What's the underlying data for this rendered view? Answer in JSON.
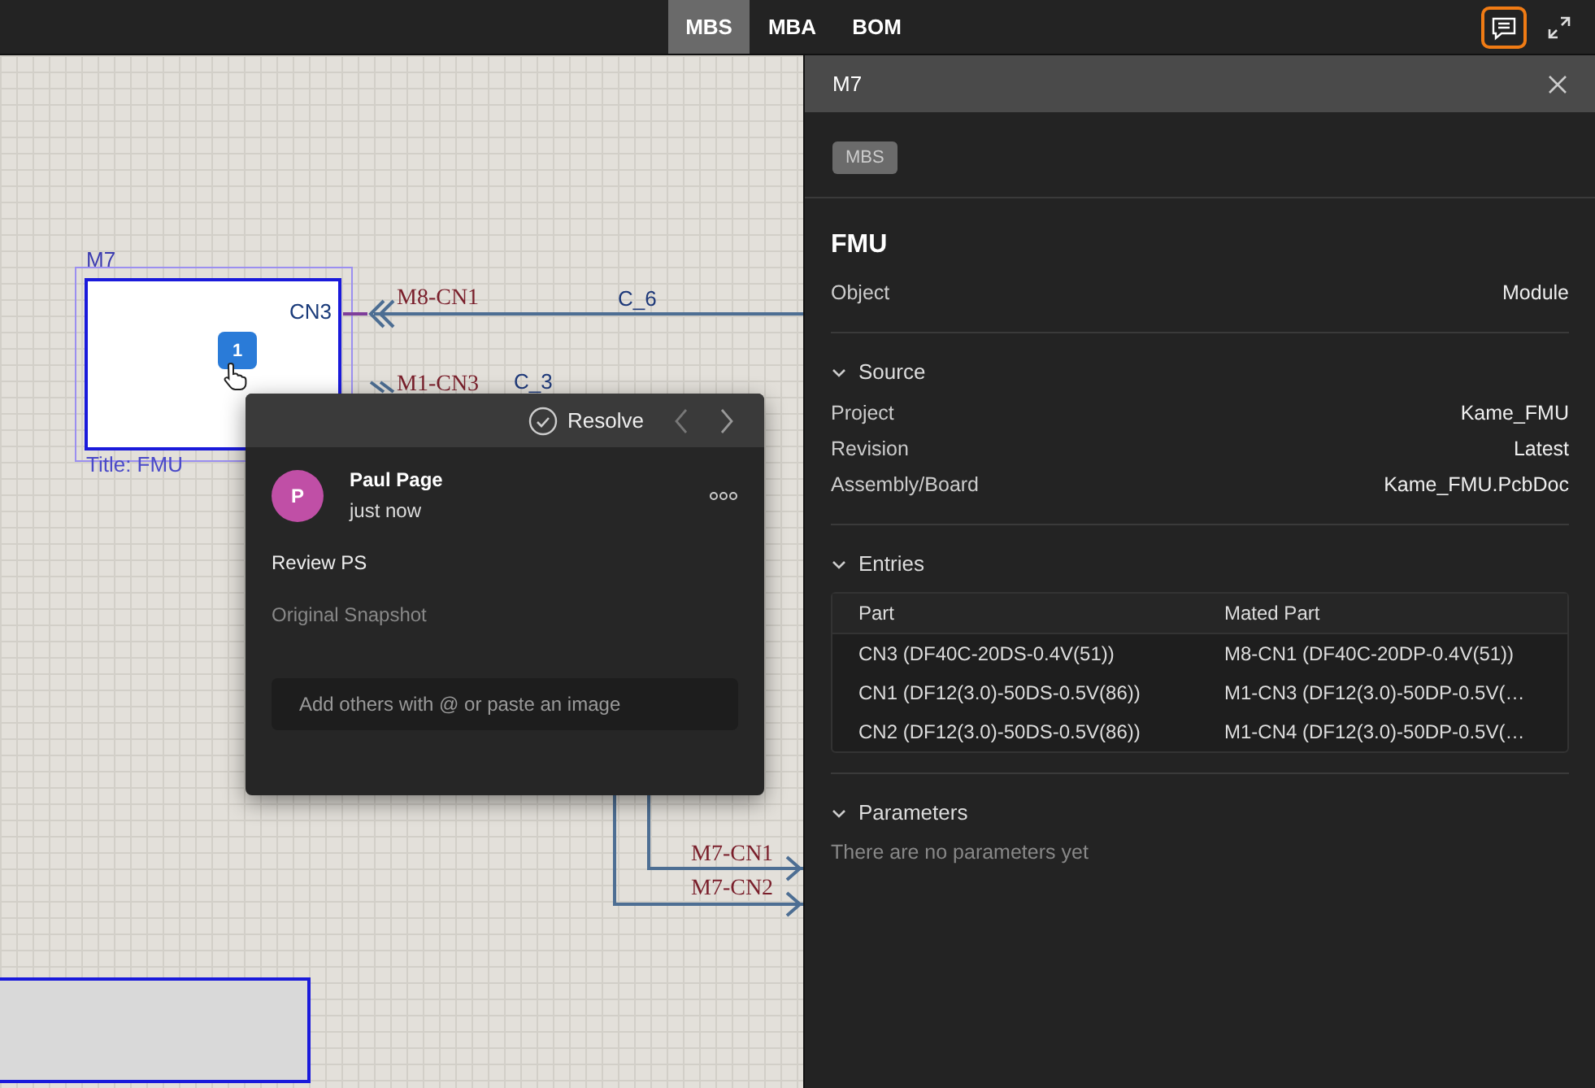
{
  "top_bar": {
    "tabs": [
      {
        "label": "MBS",
        "selected": true
      },
      {
        "label": "MBA",
        "selected": false
      },
      {
        "label": "BOM",
        "selected": false
      }
    ],
    "comments_active": true
  },
  "canvas": {
    "module": {
      "designator": "M7",
      "port": "CN3",
      "title": "Title: FMU",
      "selected": true
    },
    "comment_pin": "1",
    "net_labels": [
      {
        "text": "M8-CN1",
        "kind": "net"
      },
      {
        "text": "C_6",
        "kind": "cable"
      },
      {
        "text": "M1-CN3",
        "kind": "net"
      },
      {
        "text": "C_3",
        "kind": "cable"
      },
      {
        "text": "M7-CN1",
        "kind": "net"
      },
      {
        "text": "M7-CN2",
        "kind": "net"
      }
    ]
  },
  "comment_popup": {
    "resolve": "Resolve",
    "author": {
      "initial": "P",
      "name": "Paul Page",
      "color": "#c04fa6"
    },
    "time": "just now",
    "message": "Review PS",
    "snapshot": "Original Snapshot",
    "reply": {
      "placeholder": "Add others with @ or paste an image"
    }
  },
  "panel": {
    "title": "M7",
    "tag": "MBS",
    "heading": "FMU",
    "object": {
      "label": "Object",
      "value": "Module"
    },
    "sections": [
      {
        "title": "Source",
        "expanded": true,
        "kind": "properties",
        "rows": [
          {
            "label": "Project",
            "value": "Kame_FMU"
          },
          {
            "label": "Revision",
            "value": "Latest"
          },
          {
            "label": "Assembly/Board",
            "value": "Kame_FMU.PcbDoc"
          }
        ]
      },
      {
        "title": "Entries",
        "expanded": true,
        "kind": "table",
        "columns": [
          "Part",
          "Mated Part"
        ],
        "rows": [
          [
            "CN3 (DF40C-20DS-0.4V(51))",
            "M8-CN1 (DF40C-20DP-0.4V(51))"
          ],
          [
            "CN1 (DF12(3.0)-50DS-0.5V(86))",
            "M1-CN3 (DF12(3.0)-50DP-0.5V(…"
          ],
          [
            "CN2 (DF12(3.0)-50DS-0.5V(86))",
            "M1-CN4 (DF12(3.0)-50DP-0.5V(…"
          ]
        ]
      },
      {
        "title": "Parameters",
        "expanded": true,
        "kind": "empty",
        "empty_text": "There are no parameters yet"
      }
    ]
  }
}
